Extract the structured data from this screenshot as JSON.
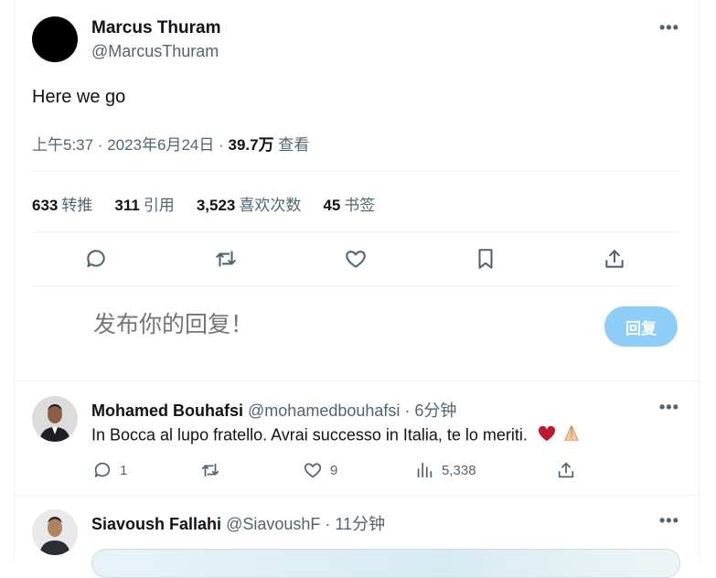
{
  "tweet": {
    "author_name": "Marcus Thuram",
    "author_handle": "@MarcusThuram",
    "text": "Here we go",
    "timestamp": "上午5:37 · 2023年6月24日 · ",
    "views_count": "39.7万",
    "views_label": " 查看",
    "stats": [
      {
        "count": "633",
        "label": "转推"
      },
      {
        "count": "311",
        "label": "引用"
      },
      {
        "count": "3,523",
        "label": "喜欢次数"
      },
      {
        "count": "45",
        "label": "书签"
      }
    ],
    "actions": [
      "reply-icon",
      "retweet-icon",
      "like-icon",
      "bookmark-icon",
      "share-icon"
    ]
  },
  "composer": {
    "placeholder": "发布你的回复！",
    "button_label": "回复",
    "button_color": "#8ecdf7"
  },
  "replies": [
    {
      "name": "Mohamed Bouhafsi",
      "handle": "@mohamedbouhafsi",
      "time": " · 6分钟",
      "text": "In Bocca al lupo fratello. Avrai successo in Italia, te lo meriti. ",
      "emojis": [
        "red-heart",
        "folded-hands"
      ],
      "reply_count": "1",
      "retweet_count": "",
      "like_count": "9",
      "view_count": "5,338"
    },
    {
      "name": "Siavoush Fallahi",
      "handle": "@SiavoushF",
      "time": " · 11分钟"
    }
  ],
  "colors": {
    "text_primary": "#0f1419",
    "text_secondary": "#536471",
    "divider": "#eff3f4"
  }
}
